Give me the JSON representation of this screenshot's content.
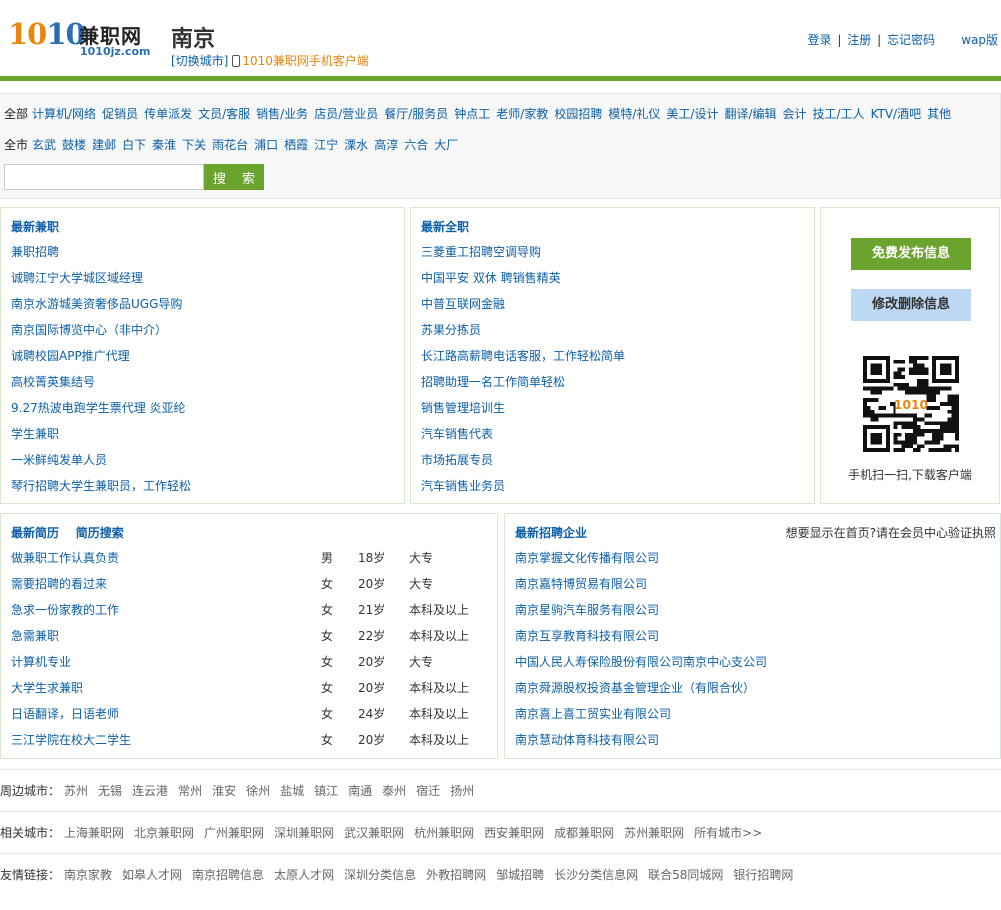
{
  "header": {
    "logo_number_a": "10",
    "logo_number_b": "10",
    "logo_cn": "兼职网",
    "logo_en": "1010jz.com",
    "city": "南京",
    "switch_city": "[切换城市]",
    "mobile_client": "1010兼职网手机客户端",
    "login": "登录",
    "register": "注册",
    "forgot": "忘记密码",
    "sep": "|",
    "wap": "wap版"
  },
  "filter": {
    "categories": [
      "全部",
      "计算机/网络",
      "促销员",
      "传单派发",
      "文员/客服",
      "销售/业务",
      "店员/营业员",
      "餐厅/服务员",
      "钟点工",
      "老师/家教",
      "校园招聘",
      "模特/礼仪",
      "美工/设计",
      "翻译/编辑",
      "会计",
      "技工/工人",
      "KTV/酒吧",
      "其他"
    ],
    "districts": [
      "全市",
      "玄武",
      "鼓楼",
      "建邺",
      "白下",
      "秦淮",
      "下关",
      "雨花台",
      "浦口",
      "栖霞",
      "江宁",
      "溧水",
      "高淳",
      "六合",
      "大厂"
    ],
    "search_value": "",
    "search_button": "搜 索"
  },
  "latest_parttime": {
    "title": "最新兼职",
    "items": [
      "兼职招聘",
      "诚聘江宁大学城区域经理",
      "南京水游城美资奢侈品UGG导购",
      "南京国际博览中心（非中介）",
      "诚聘校园APP推广代理",
      "高校菁英集结号",
      "9.27热波电跑学生票代理 炎亚纶",
      "学生兼职",
      "一米鲜纯发单人员",
      "琴行招聘大学生兼职员，工作轻松"
    ]
  },
  "latest_fulltime": {
    "title": "最新全职",
    "items": [
      "三菱重工招聘空调导购",
      "中国平安 双休 聘销售精英",
      "中普互联网金融",
      "苏果分拣员",
      "长江路高薪聘电话客服，工作轻松简单",
      "招聘助理一名工作简单轻松",
      "销售管理培训生",
      "汽车销售代表",
      "市场拓展专员",
      "汽车销售业务员"
    ]
  },
  "side": {
    "post_button": "免费发布信息",
    "edit_button": "修改删除信息",
    "qr_label": "1010",
    "qr_caption": "手机扫一扫,下载客户端"
  },
  "resumes": {
    "title": "最新简历",
    "search": "简历搜索",
    "rows": [
      {
        "title": "做兼职工作认真负责",
        "gender": "男",
        "age": "18岁",
        "edu": "大专"
      },
      {
        "title": "需要招聘的看过来",
        "gender": "女",
        "age": "20岁",
        "edu": "大专"
      },
      {
        "title": "急求一份家教的工作",
        "gender": "女",
        "age": "21岁",
        "edu": "本科及以上"
      },
      {
        "title": "急需兼职",
        "gender": "女",
        "age": "22岁",
        "edu": "本科及以上"
      },
      {
        "title": "计算机专业",
        "gender": "女",
        "age": "20岁",
        "edu": "大专"
      },
      {
        "title": "大学生求兼职",
        "gender": "女",
        "age": "20岁",
        "edu": "本科及以上"
      },
      {
        "title": "日语翻译，日语老师",
        "gender": "女",
        "age": "24岁",
        "edu": "本科及以上"
      },
      {
        "title": "三江学院在校大二学生",
        "gender": "女",
        "age": "20岁",
        "edu": "本科及以上"
      }
    ]
  },
  "companies": {
    "title": "最新招聘企业",
    "notice": "想要显示在首页?请在会员中心验证执照",
    "items": [
      "南京掌握文化传播有限公司",
      "南京嘉特博贸易有限公司",
      "南京星驹汽车服务有限公司",
      "南京互享教育科技有限公司",
      "中国人民人寿保险股份有限公司南京中心支公司",
      "南京舜源股权投资基金管理企业（有限合伙）",
      "南京喜上喜工贸实业有限公司",
      "南京慧动体育科技有限公司"
    ]
  },
  "nearby": {
    "label": "周边城市：",
    "items": [
      "苏州",
      "无锡",
      "连云港",
      "常州",
      "淮安",
      "徐州",
      "盐城",
      "镇江",
      "南通",
      "泰州",
      "宿迁",
      "扬州"
    ]
  },
  "related": {
    "label": "相关城市：",
    "items": [
      "上海兼职网",
      "北京兼职网",
      "广州兼职网",
      "深圳兼职网",
      "武汉兼职网",
      "杭州兼职网",
      "西安兼职网",
      "成都兼职网",
      "苏州兼职网",
      "所有城市>>"
    ]
  },
  "friends": {
    "label": "友情链接：",
    "items": [
      "南京家教",
      "如皋人才网",
      "南京招聘信息",
      "太原人才网",
      "深圳分类信息",
      "外教招聘网",
      "邹城招聘",
      "长沙分类信息网",
      "联合58同城网",
      "银行招聘网"
    ]
  },
  "colors": {
    "brand_green": "#6ba32f",
    "link_blue": "#0c5fa8",
    "logo_orange": "#e8850f"
  }
}
